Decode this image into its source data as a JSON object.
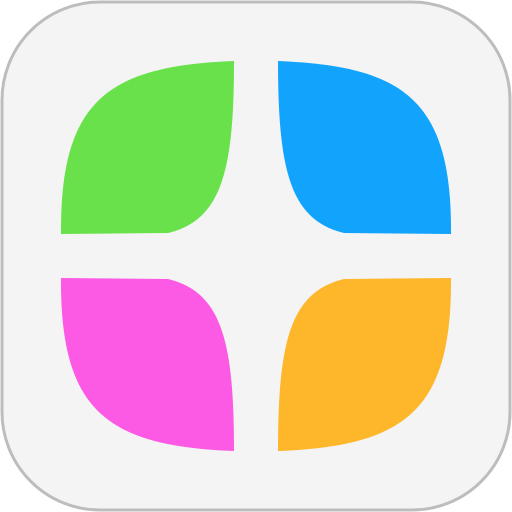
{
  "icon": {
    "kind": "app-icon",
    "shape": "rounded-square",
    "background_color": "#f4f4f4",
    "border_color": "#bdbdbd",
    "petals": [
      {
        "name": "green-petal",
        "color": "#69e14b",
        "position": "top-left"
      },
      {
        "name": "blue-petal",
        "color": "#12a4fd",
        "position": "top-right"
      },
      {
        "name": "pink-petal",
        "color": "#fc59e4",
        "position": "bottom-left"
      },
      {
        "name": "orange-petal",
        "color": "#feb72b",
        "position": "bottom-right"
      }
    ]
  }
}
